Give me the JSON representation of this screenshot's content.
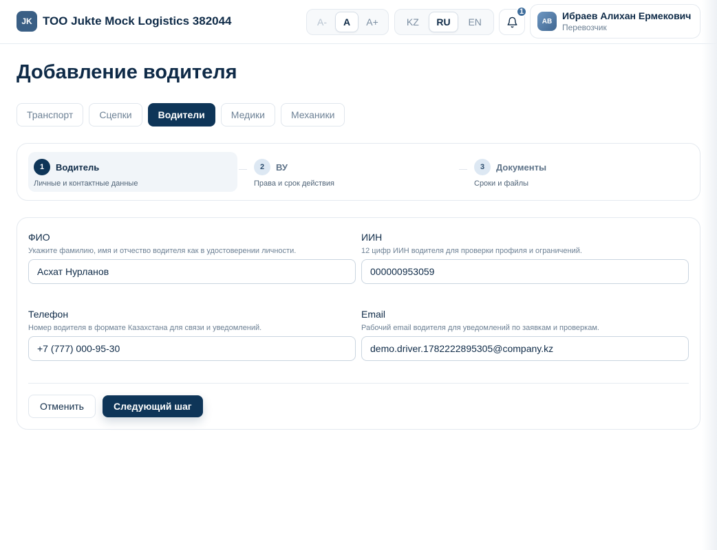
{
  "header": {
    "logo_initials": "JK",
    "company_name": "ТОО Jukte Mock Logistics 382044",
    "font_size_controls": [
      "A-",
      "A",
      "A+"
    ],
    "font_size_active": "A",
    "languages": [
      "KZ",
      "RU",
      "EN"
    ],
    "language_active": "RU",
    "notifications_count": "1",
    "user": {
      "initials": "АВ",
      "name": "Ибраев Алихан Ермекович",
      "role": "Перевозчик"
    }
  },
  "page": {
    "title": "Добавление водителя"
  },
  "tabs": [
    {
      "label": "Транспорт",
      "active": false
    },
    {
      "label": "Сцепки",
      "active": false
    },
    {
      "label": "Водители",
      "active": true
    },
    {
      "label": "Медики",
      "active": false
    },
    {
      "label": "Механики",
      "active": false
    }
  ],
  "stepper": {
    "steps": [
      {
        "number": "1",
        "title": "Водитель",
        "subtitle": "Личные и контактные данные",
        "active": true
      },
      {
        "number": "2",
        "title": "ВУ",
        "subtitle": "Права и срок действия",
        "active": false
      },
      {
        "number": "3",
        "title": "Документы",
        "subtitle": "Сроки и файлы",
        "active": false
      }
    ]
  },
  "form": {
    "fio": {
      "label": "ФИО",
      "help": "Укажите фамилию, имя и отчество водителя как в удостоверении личности.",
      "value": "Асхат Нурланов"
    },
    "iin": {
      "label": "ИИН",
      "help": "12 цифр ИИН водителя для проверки профиля и ограничений.",
      "value": "000000953059"
    },
    "phone": {
      "label": "Телефон",
      "help": "Номер водителя в формате Казахстана для связи и уведомлений.",
      "value": "+7 (777) 000-95-30"
    },
    "email": {
      "label": "Email",
      "help": "Рабочий email водителя для уведомлений по заявкам и проверкам.",
      "value": "demo.driver.1782222895305@company.kz"
    },
    "cancel_label": "Отменить",
    "next_label": "Следующий шаг"
  },
  "colors": {
    "primary": "#0e3558",
    "text": "#0e2a47",
    "muted": "#6b7f93",
    "badge": "#3e6d9c"
  }
}
